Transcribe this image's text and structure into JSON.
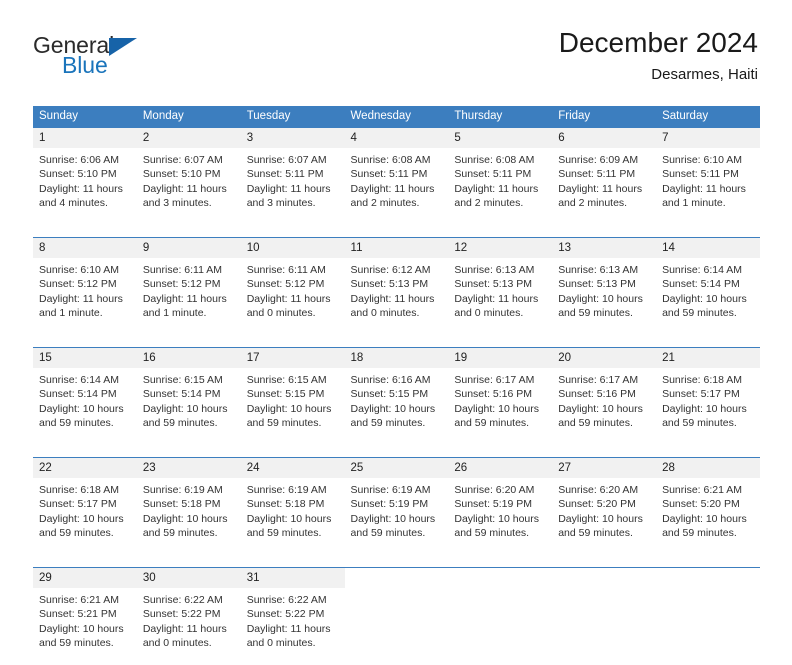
{
  "logo": {
    "word_top": "General",
    "word_bottom": "Blue",
    "triangle_color": "#1763a8",
    "blue_text_color": "#1a74bb"
  },
  "header": {
    "title": "December 2024",
    "subtitle": "Desarmes, Haiti"
  },
  "theme": {
    "header_blue": "#3c7ebf",
    "daynum_bg": "#f1f1f1",
    "text": "#333333"
  },
  "calendar": {
    "weekday_headers": [
      "Sunday",
      "Monday",
      "Tuesday",
      "Wednesday",
      "Thursday",
      "Friday",
      "Saturday"
    ],
    "weeks": [
      [
        {
          "day": "1",
          "sunrise": "Sunrise: 6:06 AM",
          "sunset": "Sunset: 5:10 PM",
          "daylight_1": "Daylight: 11 hours",
          "daylight_2": "and 4 minutes."
        },
        {
          "day": "2",
          "sunrise": "Sunrise: 6:07 AM",
          "sunset": "Sunset: 5:10 PM",
          "daylight_1": "Daylight: 11 hours",
          "daylight_2": "and 3 minutes."
        },
        {
          "day": "3",
          "sunrise": "Sunrise: 6:07 AM",
          "sunset": "Sunset: 5:11 PM",
          "daylight_1": "Daylight: 11 hours",
          "daylight_2": "and 3 minutes."
        },
        {
          "day": "4",
          "sunrise": "Sunrise: 6:08 AM",
          "sunset": "Sunset: 5:11 PM",
          "daylight_1": "Daylight: 11 hours",
          "daylight_2": "and 2 minutes."
        },
        {
          "day": "5",
          "sunrise": "Sunrise: 6:08 AM",
          "sunset": "Sunset: 5:11 PM",
          "daylight_1": "Daylight: 11 hours",
          "daylight_2": "and 2 minutes."
        },
        {
          "day": "6",
          "sunrise": "Sunrise: 6:09 AM",
          "sunset": "Sunset: 5:11 PM",
          "daylight_1": "Daylight: 11 hours",
          "daylight_2": "and 2 minutes."
        },
        {
          "day": "7",
          "sunrise": "Sunrise: 6:10 AM",
          "sunset": "Sunset: 5:11 PM",
          "daylight_1": "Daylight: 11 hours",
          "daylight_2": "and 1 minute."
        }
      ],
      [
        {
          "day": "8",
          "sunrise": "Sunrise: 6:10 AM",
          "sunset": "Sunset: 5:12 PM",
          "daylight_1": "Daylight: 11 hours",
          "daylight_2": "and 1 minute."
        },
        {
          "day": "9",
          "sunrise": "Sunrise: 6:11 AM",
          "sunset": "Sunset: 5:12 PM",
          "daylight_1": "Daylight: 11 hours",
          "daylight_2": "and 1 minute."
        },
        {
          "day": "10",
          "sunrise": "Sunrise: 6:11 AM",
          "sunset": "Sunset: 5:12 PM",
          "daylight_1": "Daylight: 11 hours",
          "daylight_2": "and 0 minutes."
        },
        {
          "day": "11",
          "sunrise": "Sunrise: 6:12 AM",
          "sunset": "Sunset: 5:13 PM",
          "daylight_1": "Daylight: 11 hours",
          "daylight_2": "and 0 minutes."
        },
        {
          "day": "12",
          "sunrise": "Sunrise: 6:13 AM",
          "sunset": "Sunset: 5:13 PM",
          "daylight_1": "Daylight: 11 hours",
          "daylight_2": "and 0 minutes."
        },
        {
          "day": "13",
          "sunrise": "Sunrise: 6:13 AM",
          "sunset": "Sunset: 5:13 PM",
          "daylight_1": "Daylight: 10 hours",
          "daylight_2": "and 59 minutes."
        },
        {
          "day": "14",
          "sunrise": "Sunrise: 6:14 AM",
          "sunset": "Sunset: 5:14 PM",
          "daylight_1": "Daylight: 10 hours",
          "daylight_2": "and 59 minutes."
        }
      ],
      [
        {
          "day": "15",
          "sunrise": "Sunrise: 6:14 AM",
          "sunset": "Sunset: 5:14 PM",
          "daylight_1": "Daylight: 10 hours",
          "daylight_2": "and 59 minutes."
        },
        {
          "day": "16",
          "sunrise": "Sunrise: 6:15 AM",
          "sunset": "Sunset: 5:14 PM",
          "daylight_1": "Daylight: 10 hours",
          "daylight_2": "and 59 minutes."
        },
        {
          "day": "17",
          "sunrise": "Sunrise: 6:15 AM",
          "sunset": "Sunset: 5:15 PM",
          "daylight_1": "Daylight: 10 hours",
          "daylight_2": "and 59 minutes."
        },
        {
          "day": "18",
          "sunrise": "Sunrise: 6:16 AM",
          "sunset": "Sunset: 5:15 PM",
          "daylight_1": "Daylight: 10 hours",
          "daylight_2": "and 59 minutes."
        },
        {
          "day": "19",
          "sunrise": "Sunrise: 6:17 AM",
          "sunset": "Sunset: 5:16 PM",
          "daylight_1": "Daylight: 10 hours",
          "daylight_2": "and 59 minutes."
        },
        {
          "day": "20",
          "sunrise": "Sunrise: 6:17 AM",
          "sunset": "Sunset: 5:16 PM",
          "daylight_1": "Daylight: 10 hours",
          "daylight_2": "and 59 minutes."
        },
        {
          "day": "21",
          "sunrise": "Sunrise: 6:18 AM",
          "sunset": "Sunset: 5:17 PM",
          "daylight_1": "Daylight: 10 hours",
          "daylight_2": "and 59 minutes."
        }
      ],
      [
        {
          "day": "22",
          "sunrise": "Sunrise: 6:18 AM",
          "sunset": "Sunset: 5:17 PM",
          "daylight_1": "Daylight: 10 hours",
          "daylight_2": "and 59 minutes."
        },
        {
          "day": "23",
          "sunrise": "Sunrise: 6:19 AM",
          "sunset": "Sunset: 5:18 PM",
          "daylight_1": "Daylight: 10 hours",
          "daylight_2": "and 59 minutes."
        },
        {
          "day": "24",
          "sunrise": "Sunrise: 6:19 AM",
          "sunset": "Sunset: 5:18 PM",
          "daylight_1": "Daylight: 10 hours",
          "daylight_2": "and 59 minutes."
        },
        {
          "day": "25",
          "sunrise": "Sunrise: 6:19 AM",
          "sunset": "Sunset: 5:19 PM",
          "daylight_1": "Daylight: 10 hours",
          "daylight_2": "and 59 minutes."
        },
        {
          "day": "26",
          "sunrise": "Sunrise: 6:20 AM",
          "sunset": "Sunset: 5:19 PM",
          "daylight_1": "Daylight: 10 hours",
          "daylight_2": "and 59 minutes."
        },
        {
          "day": "27",
          "sunrise": "Sunrise: 6:20 AM",
          "sunset": "Sunset: 5:20 PM",
          "daylight_1": "Daylight: 10 hours",
          "daylight_2": "and 59 minutes."
        },
        {
          "day": "28",
          "sunrise": "Sunrise: 6:21 AM",
          "sunset": "Sunset: 5:20 PM",
          "daylight_1": "Daylight: 10 hours",
          "daylight_2": "and 59 minutes."
        }
      ],
      [
        {
          "day": "29",
          "sunrise": "Sunrise: 6:21 AM",
          "sunset": "Sunset: 5:21 PM",
          "daylight_1": "Daylight: 10 hours",
          "daylight_2": "and 59 minutes."
        },
        {
          "day": "30",
          "sunrise": "Sunrise: 6:22 AM",
          "sunset": "Sunset: 5:22 PM",
          "daylight_1": "Daylight: 11 hours",
          "daylight_2": "and 0 minutes."
        },
        {
          "day": "31",
          "sunrise": "Sunrise: 6:22 AM",
          "sunset": "Sunset: 5:22 PM",
          "daylight_1": "Daylight: 11 hours",
          "daylight_2": "and 0 minutes."
        },
        {
          "day": "",
          "sunrise": "",
          "sunset": "",
          "daylight_1": "",
          "daylight_2": ""
        },
        {
          "day": "",
          "sunrise": "",
          "sunset": "",
          "daylight_1": "",
          "daylight_2": ""
        },
        {
          "day": "",
          "sunrise": "",
          "sunset": "",
          "daylight_1": "",
          "daylight_2": ""
        },
        {
          "day": "",
          "sunrise": "",
          "sunset": "",
          "daylight_1": "",
          "daylight_2": ""
        }
      ]
    ]
  }
}
